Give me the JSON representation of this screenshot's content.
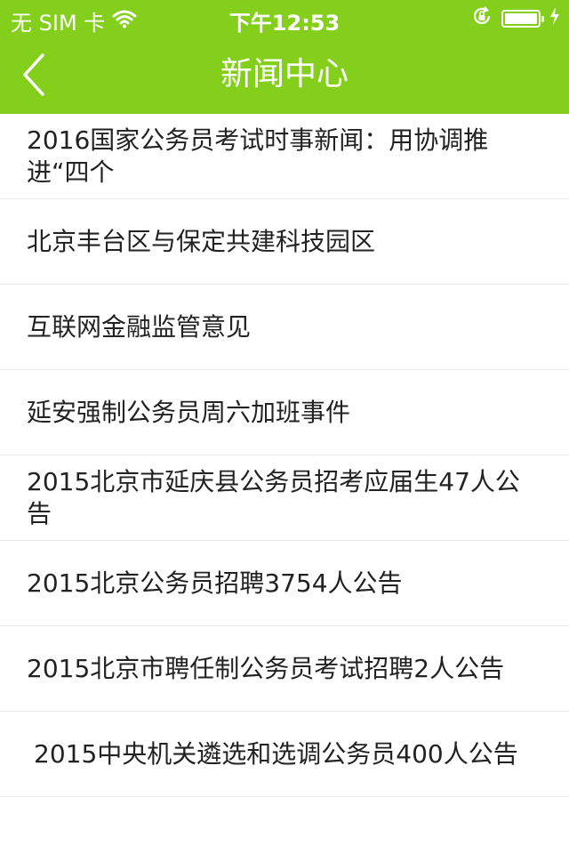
{
  "status_bar": {
    "carrier": "无 SIM 卡",
    "time": "下午12:53",
    "battery_level": 1.0
  },
  "nav": {
    "title": "新闻中心"
  },
  "news": [
    {
      "title": "2016国家公务员考试时事新闻：用协调推进“四个"
    },
    {
      "title": "北京丰台区与保定共建科技园区"
    },
    {
      "title": "互联网金融监管意见"
    },
    {
      "title": "延安强制公务员周六加班事件"
    },
    {
      "title": "2015北京市延庆县公务员招考应届生47人公告"
    },
    {
      "title": "2015北京公务员招聘3754人公告"
    },
    {
      "title": "2015北京市聘任制公务员考试招聘2人公告"
    },
    {
      "title": "2015中央机关遴选和选调公务员400人公告"
    }
  ],
  "colors": {
    "accent": "#84cf1c",
    "text": "#222222",
    "divider": "#e8e8e8"
  }
}
